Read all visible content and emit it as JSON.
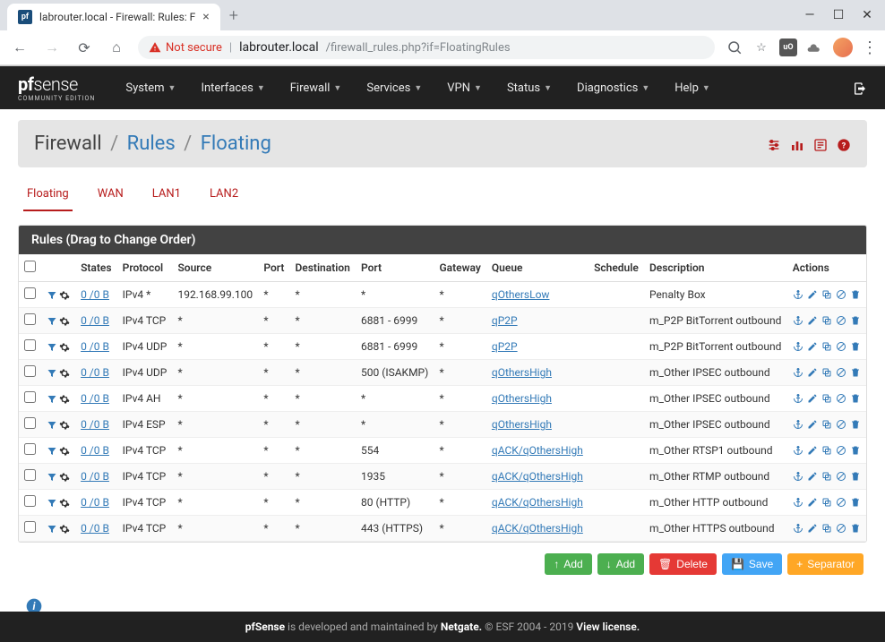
{
  "browser": {
    "tab_title": "labrouter.local - Firewall: Rules: F",
    "tab_favicon": "pf",
    "not_secure": "Not secure",
    "url_host": "labrouter.local",
    "url_path": "/firewall_rules.php?if=FloatingRules"
  },
  "nav": {
    "logo1": "pf",
    "logo2": "sense",
    "logo_sub": "COMMUNITY EDITION",
    "items": [
      "System",
      "Interfaces",
      "Firewall",
      "Services",
      "VPN",
      "Status",
      "Diagnostics",
      "Help"
    ]
  },
  "breadcrumb": {
    "root": "Firewall",
    "mid": "Rules",
    "leaf": "Floating"
  },
  "subtabs": [
    "Floating",
    "WAN",
    "LAN1",
    "LAN2"
  ],
  "active_subtab": "Floating",
  "panel_title": "Rules (Drag to Change Order)",
  "columns": [
    "",
    "",
    "States",
    "Protocol",
    "Source",
    "Port",
    "Destination",
    "Port",
    "Gateway",
    "Queue",
    "Schedule",
    "Description",
    "Actions"
  ],
  "rules": [
    {
      "states": "0 /0 B",
      "protocol": "IPv4 *",
      "source": "192.168.99.100",
      "sport": "*",
      "dest": "*",
      "dport": "*",
      "gateway": "*",
      "queue": "qOthersLow",
      "schedule": "",
      "desc": "Penalty Box"
    },
    {
      "states": "0 /0 B",
      "protocol": "IPv4 TCP",
      "source": "*",
      "sport": "*",
      "dest": "*",
      "dport": "6881 - 6999",
      "gateway": "*",
      "queue": "qP2P",
      "schedule": "",
      "desc": "m_P2P BitTorrent outbound"
    },
    {
      "states": "0 /0 B",
      "protocol": "IPv4 UDP",
      "source": "*",
      "sport": "*",
      "dest": "*",
      "dport": "6881 - 6999",
      "gateway": "*",
      "queue": "qP2P",
      "schedule": "",
      "desc": "m_P2P BitTorrent outbound"
    },
    {
      "states": "0 /0 B",
      "protocol": "IPv4 UDP",
      "source": "*",
      "sport": "*",
      "dest": "*",
      "dport": "500 (ISAKMP)",
      "gateway": "*",
      "queue": "qOthersHigh",
      "schedule": "",
      "desc": "m_Other IPSEC outbound"
    },
    {
      "states": "0 /0 B",
      "protocol": "IPv4 AH",
      "source": "*",
      "sport": "*",
      "dest": "*",
      "dport": "*",
      "gateway": "*",
      "queue": "qOthersHigh",
      "schedule": "",
      "desc": "m_Other IPSEC outbound"
    },
    {
      "states": "0 /0 B",
      "protocol": "IPv4 ESP",
      "source": "*",
      "sport": "*",
      "dest": "*",
      "dport": "*",
      "gateway": "*",
      "queue": "qOthersHigh",
      "schedule": "",
      "desc": "m_Other IPSEC outbound"
    },
    {
      "states": "0 /0 B",
      "protocol": "IPv4 TCP",
      "source": "*",
      "sport": "*",
      "dest": "*",
      "dport": "554",
      "gateway": "*",
      "queue": "qACK/qOthersHigh",
      "schedule": "",
      "desc": "m_Other RTSP1 outbound"
    },
    {
      "states": "0 /0 B",
      "protocol": "IPv4 TCP",
      "source": "*",
      "sport": "*",
      "dest": "*",
      "dport": "1935",
      "gateway": "*",
      "queue": "qACK/qOthersHigh",
      "schedule": "",
      "desc": "m_Other RTMP outbound"
    },
    {
      "states": "0 /0 B",
      "protocol": "IPv4 TCP",
      "source": "*",
      "sport": "*",
      "dest": "*",
      "dport": "80 (HTTP)",
      "gateway": "*",
      "queue": "qACK/qOthersHigh",
      "schedule": "",
      "desc": "m_Other HTTP outbound"
    },
    {
      "states": "0 /0 B",
      "protocol": "IPv4 TCP",
      "source": "*",
      "sport": "*",
      "dest": "*",
      "dport": "443 (HTTPS)",
      "gateway": "*",
      "queue": "qACK/qOthersHigh",
      "schedule": "",
      "desc": "m_Other HTTPS outbound"
    }
  ],
  "buttons": {
    "add1": "Add",
    "add2": "Add",
    "delete": "Delete",
    "save": "Save",
    "separator": "Separator"
  },
  "footer": {
    "t1": "pfSense",
    "t2": " is developed and maintained by ",
    "t3": "Netgate.",
    "t4": " © ESF 2004 - 2019 ",
    "t5": "View license."
  }
}
